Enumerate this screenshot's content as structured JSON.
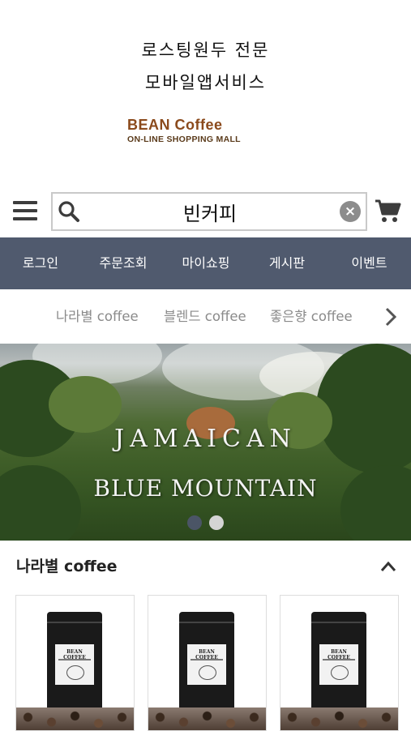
{
  "header": {
    "tagline_line1": "로스팅원두 전문",
    "tagline_line2": "모바일앱서비스",
    "logo_main": "BEAN Coffee",
    "logo_sub": "ON-LINE SHOPPING MALL"
  },
  "search": {
    "value": "빈커피",
    "clear_label": "×"
  },
  "nav": {
    "items": [
      {
        "label": "로그인"
      },
      {
        "label": "주문조회"
      },
      {
        "label": "마이쇼핑"
      },
      {
        "label": "게시판"
      },
      {
        "label": "이벤트"
      }
    ]
  },
  "categories": {
    "items": [
      {
        "label": "나라별 coffee"
      },
      {
        "label": "블렌드 coffee"
      },
      {
        "label": "좋은향 coffee"
      }
    ]
  },
  "banner": {
    "line1": "JAMAICAN",
    "line2": "BLUE MOUNTAIN",
    "slide_count": 2,
    "active_slide": 1
  },
  "section": {
    "title": "나라별 coffee"
  },
  "products": {
    "bag_label": "BEAN COFFEE",
    "count": 3
  },
  "colors": {
    "nav_bg": "#505a6e",
    "logo_brown": "#8b4a1c",
    "category_text": "#8a8a8a"
  },
  "icons": [
    "menu-icon",
    "search-icon",
    "clear-icon",
    "cart-icon",
    "chevron-right-icon",
    "chevron-up-icon"
  ]
}
